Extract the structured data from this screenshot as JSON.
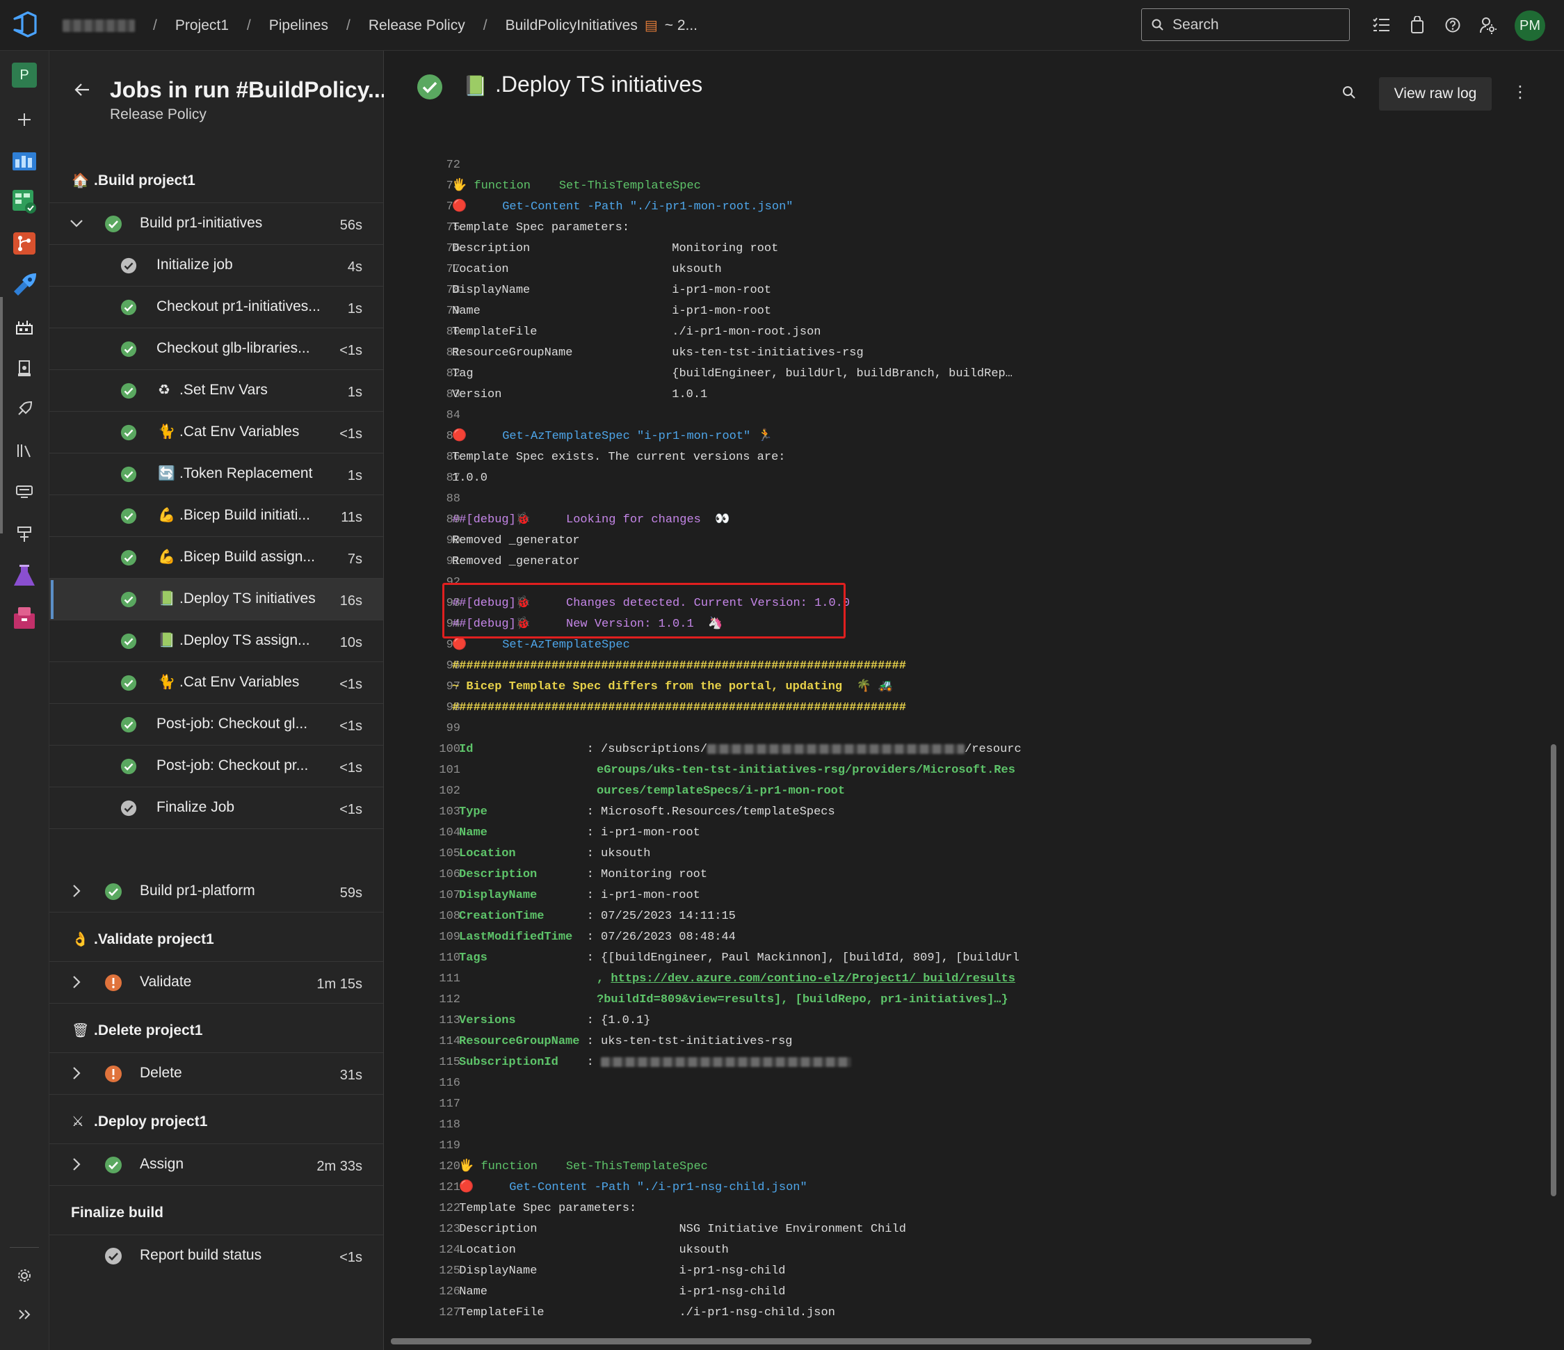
{
  "topbar": {
    "breadcrumbs": [
      "Project1",
      "Pipelines",
      "Release Policy",
      "BuildPolicyInitiatives"
    ],
    "separator": "/",
    "run_suffix": "~ 2...",
    "search_placeholder": "Search",
    "avatar_initials": "PM"
  },
  "rail": {
    "project_badge": "P"
  },
  "jobs_panel": {
    "title": "Jobs in run #BuildPolicy...",
    "subtitle": "Release Policy",
    "stages": {
      "build": {
        "emoji": "🏠",
        "label": ".Build project1"
      },
      "validate": {
        "emoji": "👌",
        "label": ".Validate project1"
      },
      "delete": {
        "emoji": "🗑",
        "label": ".Delete project1"
      },
      "deploy": {
        "emoji": "⚔",
        "label": ".Deploy project1"
      },
      "finalize": {
        "label": "Finalize build"
      }
    },
    "jobs": {
      "build_initiatives": {
        "label": "Build pr1-initiatives",
        "duration": "56s",
        "status": "success"
      },
      "build_platform": {
        "label": "Build pr1-platform",
        "duration": "59s",
        "status": "success"
      },
      "validate": {
        "label": "Validate",
        "duration": "1m 15s",
        "status": "warning"
      },
      "delete": {
        "label": "Delete",
        "duration": "31s",
        "status": "warning"
      },
      "assign": {
        "label": "Assign",
        "duration": "2m 33s",
        "status": "success"
      },
      "report": {
        "label": "Report build status",
        "duration": "<1s",
        "status": "neutral"
      }
    },
    "steps": [
      {
        "label": "Initialize job",
        "duration": "4s",
        "status": "neutral",
        "icon": ""
      },
      {
        "label": "Checkout pr1-initiatives...",
        "duration": "1s",
        "status": "success",
        "icon": ""
      },
      {
        "label": "Checkout glb-libraries...",
        "duration": "<1s",
        "status": "success",
        "icon": ""
      },
      {
        "label": ".Set Env Vars",
        "duration": "1s",
        "status": "success",
        "icon": "♻"
      },
      {
        "label": ".Cat Env Variables",
        "duration": "<1s",
        "status": "success",
        "icon": "🐈"
      },
      {
        "label": ".Token Replacement",
        "duration": "1s",
        "status": "success",
        "icon": "🔄"
      },
      {
        "label": ".Bicep Build initiati...",
        "duration": "11s",
        "status": "success",
        "icon": "💪"
      },
      {
        "label": ".Bicep Build assign...",
        "duration": "7s",
        "status": "success",
        "icon": "💪"
      },
      {
        "label": ".Deploy TS initiatives",
        "duration": "16s",
        "status": "success",
        "icon": "📗"
      },
      {
        "label": ".Deploy TS assign...",
        "duration": "10s",
        "status": "success",
        "icon": "📗"
      },
      {
        "label": ".Cat Env Variables",
        "duration": "<1s",
        "status": "success",
        "icon": "🐈"
      },
      {
        "label": "Post-job: Checkout gl...",
        "duration": "<1s",
        "status": "success",
        "icon": ""
      },
      {
        "label": "Post-job: Checkout pr...",
        "duration": "<1s",
        "status": "success",
        "icon": ""
      },
      {
        "label": "Finalize Job",
        "duration": "<1s",
        "status": "neutral",
        "icon": ""
      }
    ]
  },
  "log": {
    "title_icon": "📗",
    "title": ".Deploy TS initiatives",
    "raw_log_label": "View raw log",
    "lines": [
      {
        "n": "72",
        "t": ""
      },
      {
        "n": "73",
        "t": "",
        "emoji": "🖐",
        "fn": "function",
        "name": "Set-ThisTemplateSpec"
      },
      {
        "n": "74",
        "t": "",
        "emoji": "🔴",
        "cmd": "Get-Content -Path",
        "str": "\"./i-pr1-mon-root.json\""
      },
      {
        "n": "75",
        "t": "Template Spec parameters:"
      },
      {
        "n": "76",
        "t": "Description                    Monitoring root"
      },
      {
        "n": "77",
        "t": "Location                       uksouth"
      },
      {
        "n": "78",
        "t": "DisplayName                    i-pr1-mon-root"
      },
      {
        "n": "79",
        "t": "Name                           i-pr1-mon-root"
      },
      {
        "n": "80",
        "t": "TemplateFile                   ./i-pr1-mon-root.json"
      },
      {
        "n": "81",
        "t": "ResourceGroupName              uks-ten-tst-initiatives-rsg"
      },
      {
        "n": "82",
        "t": "Tag                            {buildEngineer, buildUrl, buildBranch, buildRep…"
      },
      {
        "n": "83",
        "t": "Version                        1.0.1"
      },
      {
        "n": "84",
        "t": ""
      },
      {
        "n": "85",
        "t": "",
        "emoji": "🔴",
        "cmd": "Get-AzTemplateSpec",
        "str": "\"i-pr1-mon-root\"",
        "emoji2": "🏃"
      },
      {
        "n": "86",
        "t": "Template Spec exists. The current versions are:"
      },
      {
        "n": "87",
        "t": "1.0.0"
      },
      {
        "n": "88",
        "t": ""
      },
      {
        "n": "89",
        "t": "",
        "dbg": "##[debug]",
        "emoji": "🐞",
        "dbgmsg": "Looking for changes",
        "emoji2": "👀"
      },
      {
        "n": "90",
        "t": "Removed _generator"
      },
      {
        "n": "91",
        "t": "Removed _generator"
      },
      {
        "n": "92",
        "t": ""
      },
      {
        "n": "93",
        "t": "",
        "dbg": "##[debug]",
        "emoji": "🐞",
        "dbgmsg": "Changes detected. Current Version: 1.0.0"
      },
      {
        "n": "94",
        "t": "",
        "dbg": "##[debug]",
        "emoji": "🐞",
        "dbgmsg": "New Version: 1.0.1",
        "emoji2": "🦄"
      },
      {
        "n": "95",
        "t": "",
        "emoji": "🔴",
        "cmd": "Set-AzTemplateSpec"
      },
      {
        "n": "96",
        "t": "",
        "yel": "################################################################"
      },
      {
        "n": "97",
        "t": "",
        "yel": "~ Bicep Template Spec differs from the portal, updating",
        "emoji2": "🌴 🚜"
      },
      {
        "n": "98",
        "t": "",
        "yel": "################################################################"
      },
      {
        "n": "99",
        "t": ""
      },
      {
        "n": "100",
        "t": "",
        "key": "Id                ",
        "val": ": /subscriptions/",
        "redact": 370,
        "val2": "/resourc",
        "plainval": true
      },
      {
        "n": "101",
        "t": "",
        "cont": "eGroups/uks-ten-tst-initiatives-rsg/providers/Microsoft.Res"
      },
      {
        "n": "102",
        "t": "",
        "cont": "ources/templateSpecs/i-pr1-mon-root"
      },
      {
        "n": "103",
        "t": "",
        "key": "Type              ",
        "val": ": Microsoft.Resources/templateSpecs"
      },
      {
        "n": "104",
        "t": "",
        "key": "Name              ",
        "val": ": i-pr1-mon-root"
      },
      {
        "n": "105",
        "t": "",
        "key": "Location          ",
        "val": ": uksouth"
      },
      {
        "n": "106",
        "t": "",
        "key": "Description       ",
        "val": ": Monitoring root"
      },
      {
        "n": "107",
        "t": "",
        "key": "DisplayName       ",
        "val": ": i-pr1-mon-root"
      },
      {
        "n": "108",
        "t": "",
        "key": "CreationTime      ",
        "val": ": 07/25/2023 14:11:15"
      },
      {
        "n": "109",
        "t": "",
        "key": "LastModifiedTime  ",
        "val": ": 07/26/2023 08:48:44"
      },
      {
        "n": "110",
        "t": "",
        "key": "Tags              ",
        "val": ": {[buildEngineer, Paul Mackinnon], [buildId, 809], [buildUrl"
      },
      {
        "n": "111",
        "t": "",
        "contpre": ", ",
        "link": "https://dev.azure.com/contino-elz/Project1/_build/results"
      },
      {
        "n": "112",
        "t": "",
        "cont": "?buildId=809&view=results], [buildRepo, pr1-initiatives]…}"
      },
      {
        "n": "113",
        "t": "",
        "key": "Versions          ",
        "val": ": {1.0.1}"
      },
      {
        "n": "114",
        "t": "",
        "key": "ResourceGroupName ",
        "val": ": uks-ten-tst-initiatives-rsg"
      },
      {
        "n": "115",
        "t": "",
        "key": "SubscriptionId    ",
        "val": ": ",
        "redact": 360
      },
      {
        "n": "116",
        "t": ""
      },
      {
        "n": "117",
        "t": ""
      },
      {
        "n": "118",
        "t": ""
      },
      {
        "n": "119",
        "t": ""
      },
      {
        "n": "120",
        "t": "",
        "emoji": "🖐",
        "fn": "function",
        "name": "Set-ThisTemplateSpec",
        "indent": true
      },
      {
        "n": "121",
        "t": "",
        "emoji": "🔴",
        "cmd": "Get-Content -Path",
        "str": "\"./i-pr1-nsg-child.json\"",
        "indent": true
      },
      {
        "n": "122",
        "t": " Template Spec parameters:"
      },
      {
        "n": "123",
        "t": " Description                    NSG Initiative Environment Child"
      },
      {
        "n": "124",
        "t": " Location                       uksouth"
      },
      {
        "n": "125",
        "t": " DisplayName                    i-pr1-nsg-child"
      },
      {
        "n": "126",
        "t": " Name                           i-pr1-nsg-child"
      },
      {
        "n": "127",
        "t": " TemplateFile                   ./i-pr1-nsg-child.json"
      }
    ]
  }
}
